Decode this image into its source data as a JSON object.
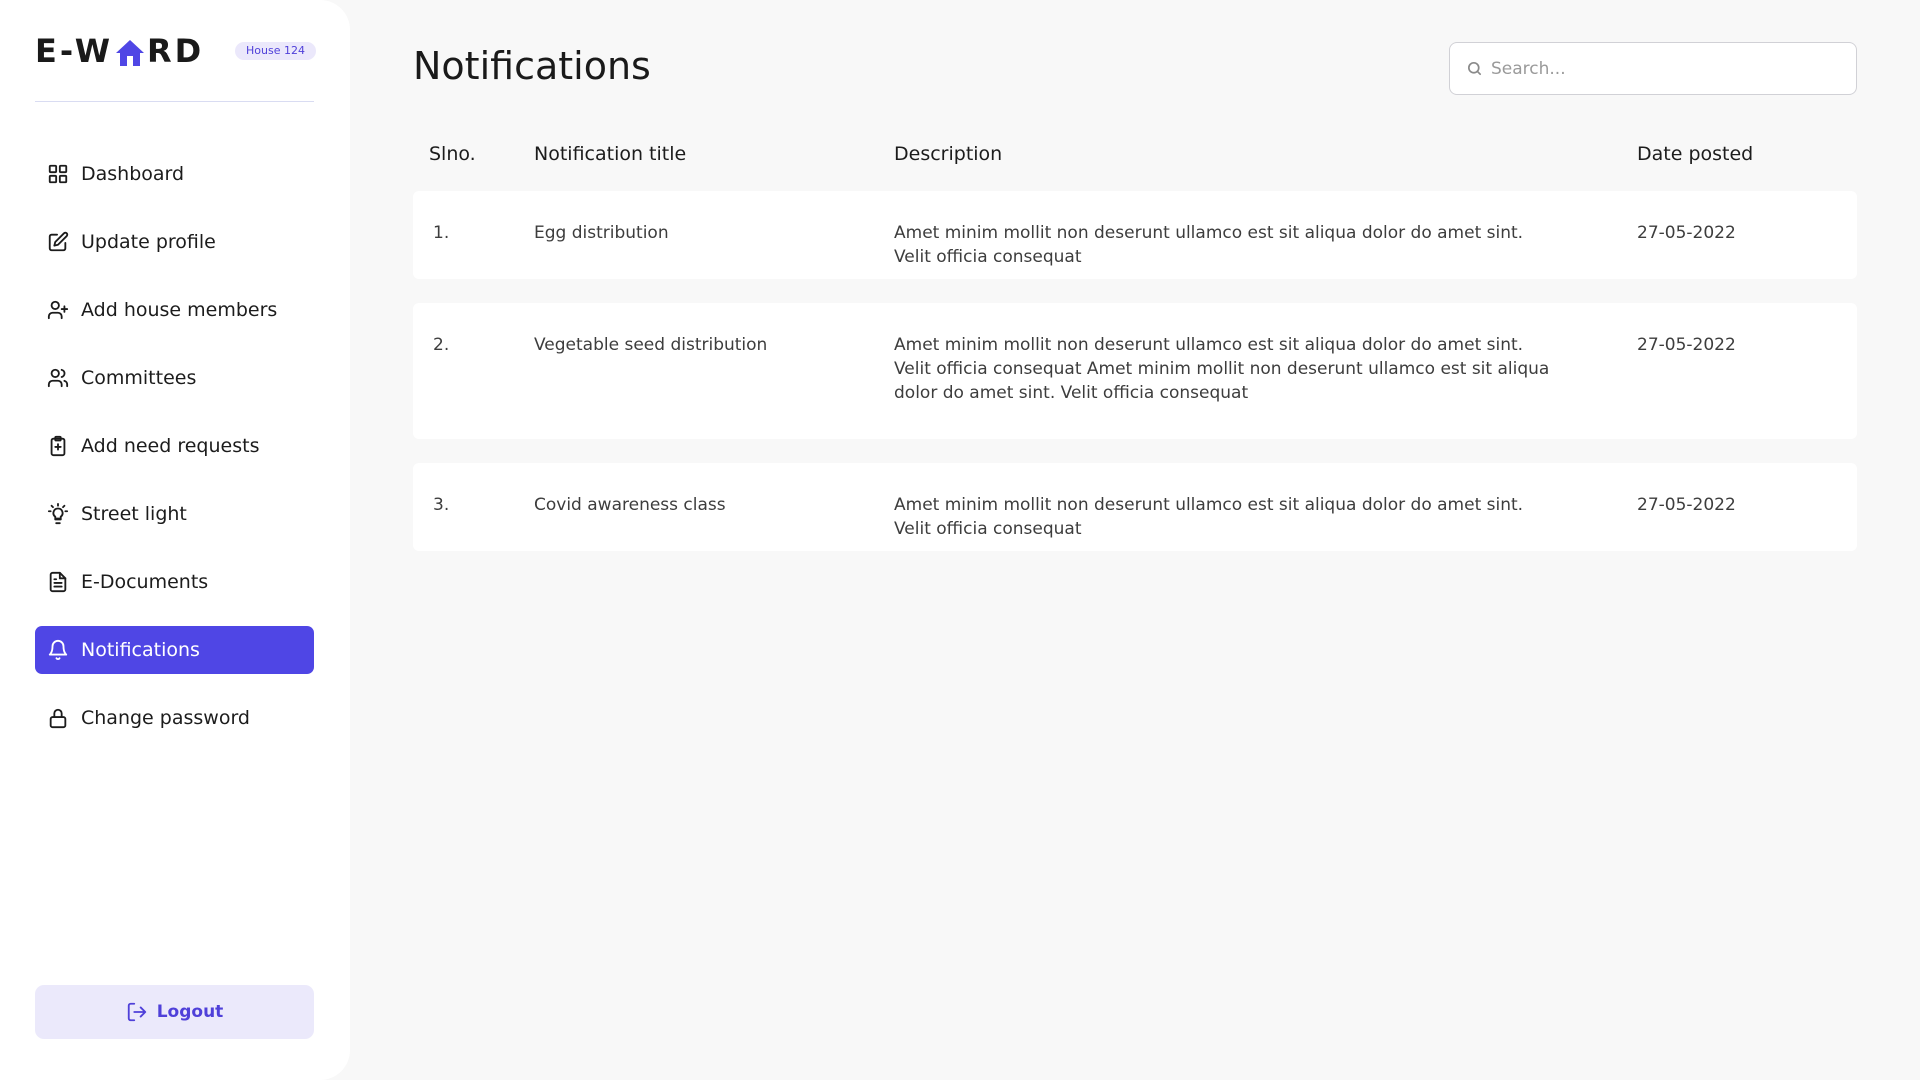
{
  "brand": {
    "logo_text_left": "E-W",
    "logo_text_right": "RD",
    "house_badge": "House 124"
  },
  "sidebar": {
    "items": [
      {
        "label": "Dashboard",
        "icon": "grid-icon",
        "active": false
      },
      {
        "label": "Update profile",
        "icon": "edit-icon",
        "active": false
      },
      {
        "label": "Add house members",
        "icon": "user-plus-icon",
        "active": false
      },
      {
        "label": "Committees",
        "icon": "users-icon",
        "active": false
      },
      {
        "label": "Add need requests",
        "icon": "clipboard-plus-icon",
        "active": false
      },
      {
        "label": "Street light",
        "icon": "lightbulb-icon",
        "active": false
      },
      {
        "label": "E-Documents",
        "icon": "document-icon",
        "active": false
      },
      {
        "label": "Notifications",
        "icon": "bell-icon",
        "active": true
      },
      {
        "label": "Change password",
        "icon": "lock-icon",
        "active": false
      }
    ],
    "logout_label": "Logout"
  },
  "main": {
    "title": "Notifications",
    "search": {
      "placeholder": "Search...",
      "value": ""
    },
    "table": {
      "headers": [
        "Slno.",
        "Notification title",
        "Description",
        "Date posted"
      ],
      "rows": [
        {
          "no": "1.",
          "title": "Egg distribution",
          "description": "Amet minim mollit non deserunt ullamco est sit aliqua dolor do amet sint. Velit officia consequat",
          "date": "27-05-2022"
        },
        {
          "no": "2.",
          "title": "Vegetable seed distribution",
          "description": "Amet minim mollit non deserunt ullamco est sit aliqua dolor do amet sint. Velit officia consequat Amet minim mollit non deserunt ullamco est sit aliqua dolor do amet sint. Velit officia consequat",
          "date": "27-05-2022"
        },
        {
          "no": "3.",
          "title": "Covid awareness class",
          "description": "Amet minim mollit non deserunt ullamco est sit aliqua dolor do amet sint. Velit officia consequat",
          "date": "27-05-2022"
        }
      ]
    }
  },
  "colors": {
    "accent": "#4f46e5",
    "accent_soft": "#ebe9fb",
    "background": "#f8f8f8"
  }
}
